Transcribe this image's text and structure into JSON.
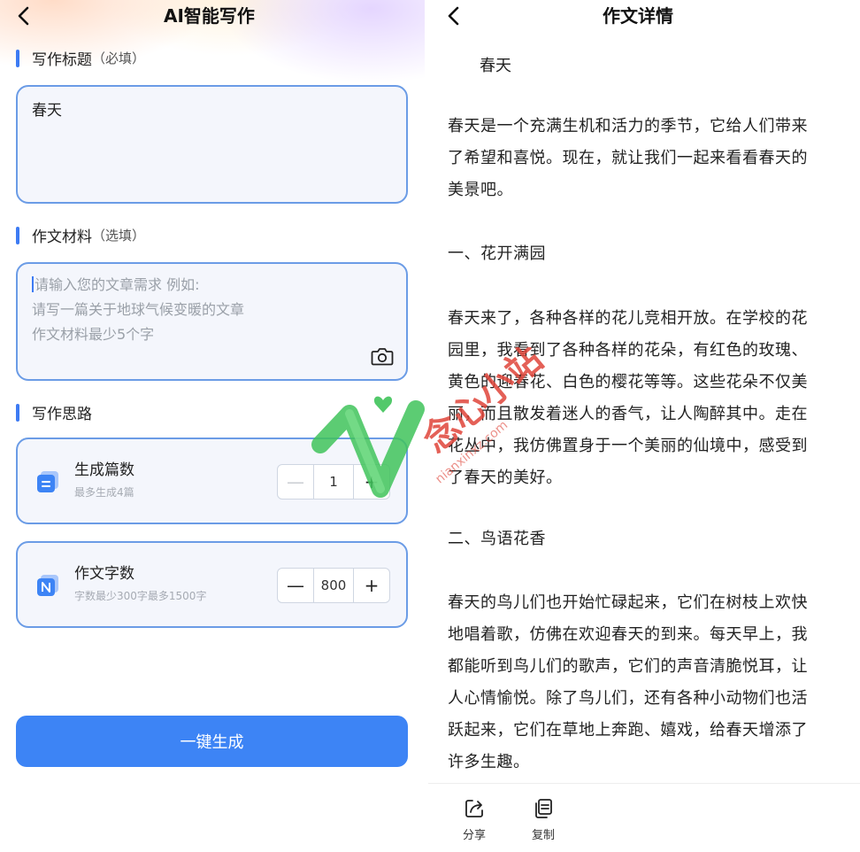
{
  "left": {
    "header": {
      "title": "AI智能写作"
    },
    "title_section": {
      "label": "写作标题",
      "hint": "（必填）",
      "value": "春天"
    },
    "material_section": {
      "label": "作文材料",
      "hint": "（选填）",
      "placeholder_lines": [
        "请输入您的文章需求 例如:",
        "请写一篇关于地球气候变暖的文章",
        "作文材料最少5个字"
      ]
    },
    "idea_section": {
      "label": "写作思路"
    },
    "count_card": {
      "title": "生成篇数",
      "subtitle": "最多生成4篇",
      "value": "1",
      "minus": "—",
      "plus": "+",
      "icon": "stack-list-icon"
    },
    "words_card": {
      "title": "作文字数",
      "subtitle": "字数最少300字最多1500字",
      "value": "800",
      "minus": "—",
      "plus": "+",
      "icon": "n-stack-icon"
    },
    "generate_button": "一键生成",
    "colors": {
      "accent": "#3d84f5",
      "border": "#6b9ce6",
      "field_bg": "#f4f6fc"
    }
  },
  "right": {
    "header": {
      "title": "作文详情"
    },
    "article_title": "春天",
    "paragraphs": [
      [
        "春天是一个充满生机和活力的季节，它给人们带来",
        "了希望和喜悦。现在，就让我们一起来看看春天的",
        "美景吧。"
      ],
      [
        "一、花开满园"
      ],
      [
        "春天来了，各种各样的花儿竞相开放。在学校的花",
        "园里，我看到了各种各样的花朵，有红色的玫瑰、",
        "黄色的迎春花、白色的樱花等等。这些花朵不仅美",
        "丽，而且散发着迷人的香气，让人陶醉其中。走在",
        "花丛中，我仿佛置身于一个美丽的仙境中，感受到",
        "了春天的美好。"
      ],
      [
        "二、鸟语花香"
      ],
      [
        "春天的鸟儿们也开始忙碌起来，它们在树枝上欢快",
        "地唱着歌，仿佛在欢迎春天的到来。每天早上，我",
        "都能听到鸟儿们的歌声，它们的声音清脆悦耳，让",
        "人心情愉悦。除了鸟儿们，还有各种小动物们也活",
        "跃起来，它们在草地上奔跑、嬉戏，给春天增添了",
        "许多生趣。"
      ]
    ],
    "actions": [
      {
        "label": "分享",
        "icon": "share-icon"
      },
      {
        "label": "复制",
        "icon": "copy-icon"
      }
    ]
  },
  "watermark": {
    "text": "念心小站",
    "url": "nianxinxz.com"
  }
}
